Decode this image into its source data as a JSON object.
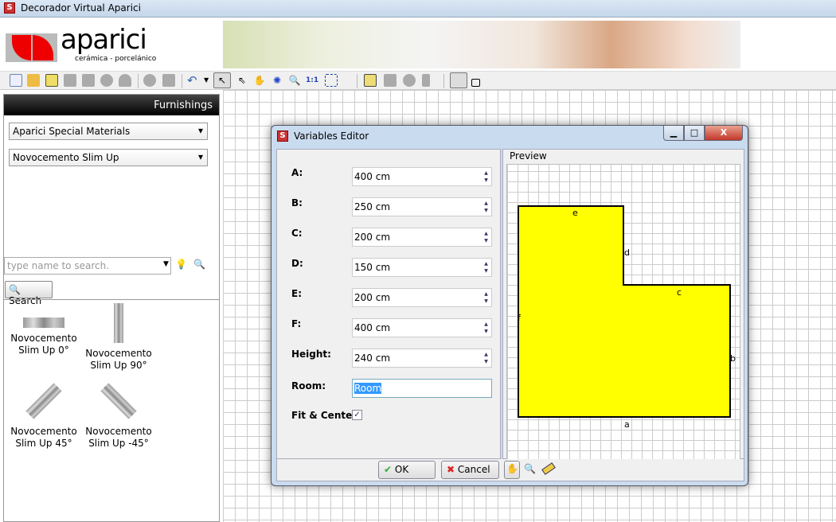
{
  "app": {
    "title": "Decorador Virtual Aparici",
    "icon": "app-house-icon"
  },
  "logo": {
    "brand": "aparici",
    "tagline": "cerámica - porcelánico"
  },
  "left_panel": {
    "header": "Furnishings",
    "category": "Aparici Special Materials",
    "collection": "Novocemento Slim Up",
    "search_placeholder": "type name to search.",
    "search_button": "Search",
    "items": [
      {
        "label": "Novocemento Slim Up 0°"
      },
      {
        "label": "Novocemento Slim Up 90°"
      },
      {
        "label": "Novocemento Slim Up 45°"
      },
      {
        "label": "Novocemento Slim Up -45°"
      }
    ]
  },
  "toolbar": {
    "icons": [
      "new-icon",
      "open-icon",
      "save-icon",
      "disabled-icon",
      "disabled-icon",
      "disabled-icon",
      "lock-icon",
      "3d-icon",
      "page-icon",
      "undo-icon",
      "select-icon",
      "multi-select-icon",
      "hand-icon",
      "rotate-icon",
      "zoom-icon",
      "zoom-1-1-icon",
      "fit-icon",
      "pencil-icon",
      "shape-icon",
      "drop-icon",
      "figure-icon",
      "wall-draw-icon",
      "room-draw-icon"
    ],
    "zoom_label": "1:1"
  },
  "dialog": {
    "title": "Variables Editor",
    "preview_label": "Preview",
    "fields": [
      {
        "label": "A:",
        "value": "400 cm"
      },
      {
        "label": "B:",
        "value": "250 cm"
      },
      {
        "label": "C:",
        "value": "200 cm"
      },
      {
        "label": "D:",
        "value": "150 cm"
      },
      {
        "label": "E:",
        "value": "200 cm"
      },
      {
        "label": "F:",
        "value": "400 cm"
      },
      {
        "label": "Height:",
        "value": "240 cm"
      }
    ],
    "room_label": "Room:",
    "room_value": "Room",
    "fit_label": "Fit & Center:",
    "fit_checked": true,
    "ok": "OK",
    "cancel": "Cancel",
    "shape_color": "#ffff00",
    "edge_labels": {
      "a": "a",
      "b": "b",
      "c": "c",
      "d": "d",
      "e": "e",
      "f": "f"
    }
  }
}
